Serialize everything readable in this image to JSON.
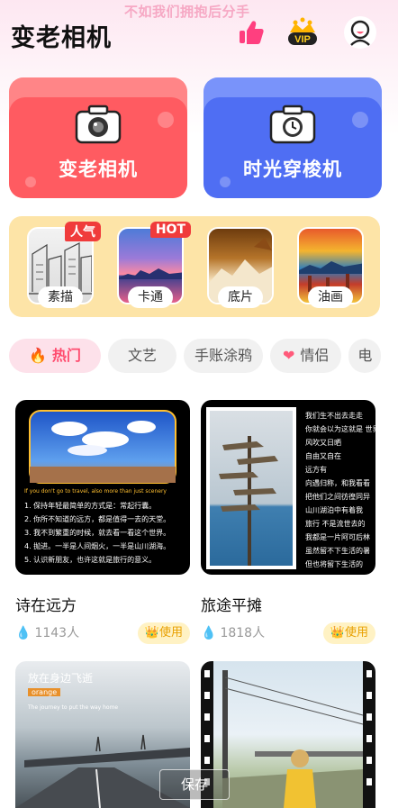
{
  "header": {
    "marquee_text": "不如我们拥抱后分手",
    "title": "变老相机",
    "vip_label": "VIP",
    "icons": [
      "thumbs-up-icon",
      "vip-crown-icon",
      "avatar-icon"
    ]
  },
  "feature_cards": [
    {
      "label": "变老相机",
      "icon": "camera-icon",
      "color": "#ff5b61"
    },
    {
      "label": "时光穿梭机",
      "icon": "clock-camera-icon",
      "color": "#4f6ef3"
    }
  ],
  "filters": [
    {
      "label": "素描",
      "badge": "人气"
    },
    {
      "label": "卡通",
      "badge": "HOT"
    },
    {
      "label": "底片",
      "badge": ""
    },
    {
      "label": "油画",
      "badge": ""
    }
  ],
  "tabs": [
    {
      "label": "热门",
      "icon": "fire-icon",
      "active": true
    },
    {
      "label": "文艺"
    },
    {
      "label": "手账涂鸦"
    },
    {
      "label": "情侣",
      "icon": "hearts-icon"
    },
    {
      "label": "电"
    }
  ],
  "templates": [
    {
      "name": "诗在远方",
      "count": "1143人",
      "use_label": "使用",
      "caption": "If you don't go to travel, also more than just scenery",
      "lines": [
        "1. 保持年轻最简单的方式是：常起行囊。",
        "2. 你所不知道的远方，都是值得一去的天堂。",
        "3. 我不到繁重的时候，就去看一看这个世界。",
        "4. 抛进。一半是人间烟火，一半是山川湖海。",
        "5. 认识新朋友，也许这就是旅行的意义。"
      ]
    },
    {
      "name": "旅途平摊",
      "count": "1818人",
      "use_label": "使用",
      "lines": [
        "我们生不出去走走",
        "你就会以为这就是 世界",
        "风吹又日晒",
        "自由又自在",
        "远方有",
        "向遇归称，和我看看",
        "把他们之间彷徨同异",
        "山川湖泊中有着我",
        "旅行 不是流世去的",
        "我都是一片阿可后林",
        "虽然留不下生活的暑",
        "但也将留下生活的"
      ]
    },
    {
      "name": "",
      "overlay_title": "放在身边飞逝",
      "overlay_tag": "orange",
      "overlay_sub": "The journey to put the way home"
    },
    {
      "name": ""
    }
  ],
  "save_label": "保存"
}
